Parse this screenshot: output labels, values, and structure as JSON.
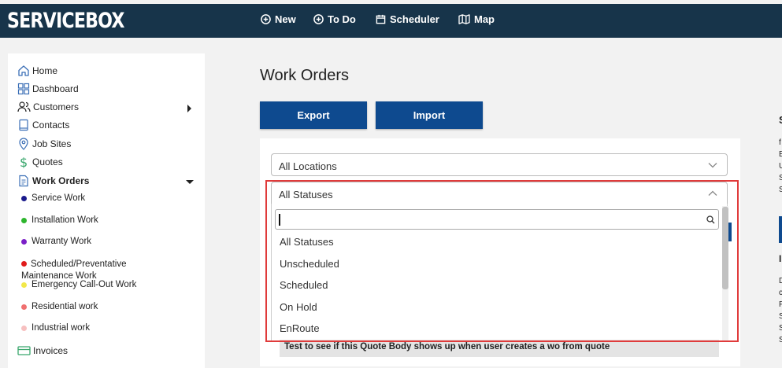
{
  "brand": {
    "logo": "SERVICEBOX"
  },
  "topnav": {
    "items": [
      {
        "label": "New",
        "icon": "plus-circle-icon"
      },
      {
        "label": "To Do",
        "icon": "plus-circle-icon"
      },
      {
        "label": "Scheduler",
        "icon": "calendar-icon"
      },
      {
        "label": "Map",
        "icon": "map-icon"
      }
    ]
  },
  "sidebar": {
    "items": [
      {
        "label": "Home",
        "icon": "home-icon"
      },
      {
        "label": "Dashboard",
        "icon": "dashboard-icon"
      },
      {
        "label": "Customers",
        "icon": "users-icon"
      },
      {
        "label": "Contacts",
        "icon": "contacts-icon"
      },
      {
        "label": "Job Sites",
        "icon": "location-pin-icon"
      },
      {
        "label": "Quotes",
        "icon": "dollar-icon"
      },
      {
        "label": "Work Orders",
        "icon": "document-icon"
      },
      {
        "label": "Invoices",
        "icon": "invoice-icon"
      }
    ],
    "work_order_types": [
      {
        "label": "Service Work",
        "color": "#1a1a8c"
      },
      {
        "label": "Installation Work",
        "color": "#2db52d"
      },
      {
        "label": "Warranty Work",
        "color": "#7a1fc7"
      },
      {
        "label": "Scheduled/Preventative Maintenance Work",
        "color": "#e01b1b"
      },
      {
        "label": "Emergency Call-Out Work",
        "color": "#f2e84a"
      },
      {
        "label": "Residential work",
        "color": "#f07070"
      },
      {
        "label": "Industrial work",
        "color": "#f7c0c0"
      }
    ]
  },
  "main": {
    "title": "Work Orders",
    "export_label": "Export",
    "import_label": "Import",
    "location_select": "All Locations",
    "status_select": "All Statuses",
    "status_options": [
      "All Statuses",
      "Unscheduled",
      "Scheduled",
      "On Hold",
      "EnRoute"
    ],
    "quote_row_text": "Test to see if this Quote Body shows up when user creates a wo from quote"
  },
  "right_fragment": {
    "heading_char": "S",
    "line_chars": [
      "f",
      "E",
      "U",
      "S",
      "S"
    ],
    "lower_heading_char": "I",
    "lower_chars": [
      "D",
      "c",
      "F",
      "S",
      "S",
      "S"
    ]
  },
  "colors": {
    "topbar": "#17344a",
    "button": "#0e4a8f",
    "highlight": "#e03b3b"
  }
}
